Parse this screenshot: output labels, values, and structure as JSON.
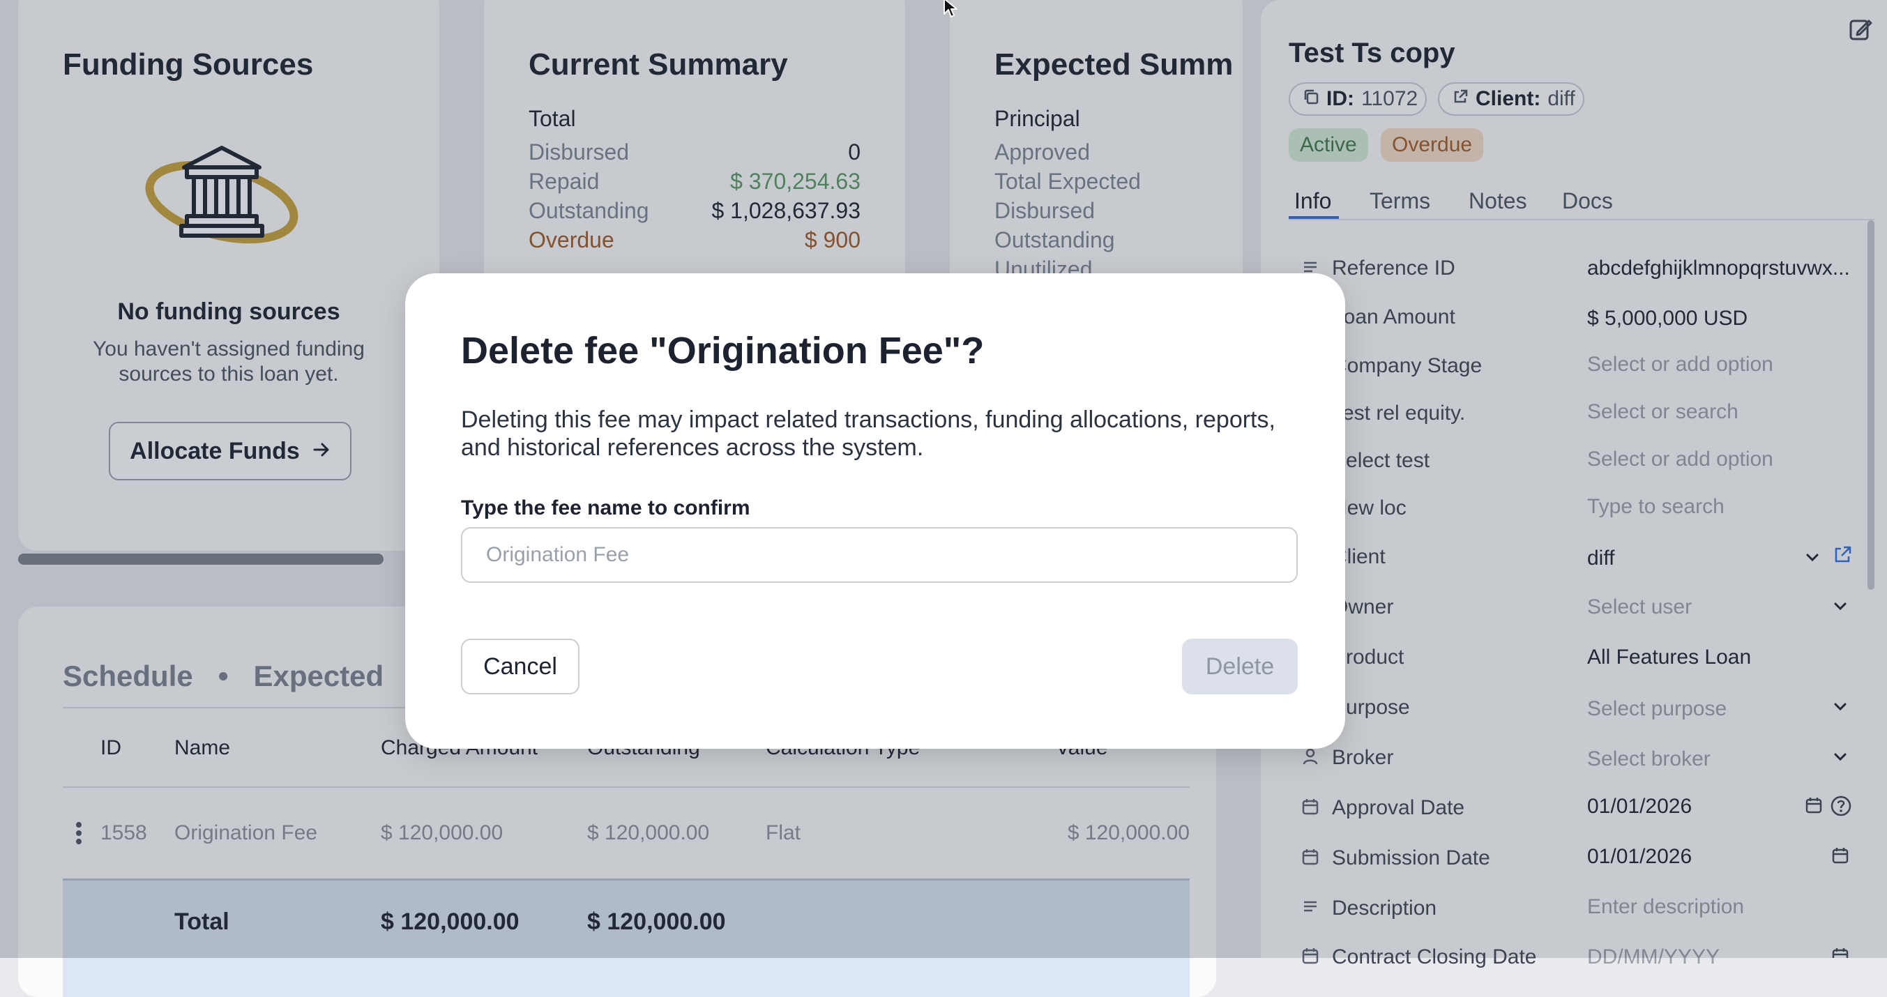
{
  "funding": {
    "title": "Funding Sources",
    "empty_title": "No funding sources",
    "empty_text_line1": "You haven't assigned funding",
    "empty_text_line2": "sources to this loan yet.",
    "allocate_label": "Allocate Funds"
  },
  "current_summary": {
    "title": "Current Summary",
    "group_label": "Total",
    "rows": [
      {
        "label": "Disbursed",
        "value": "0"
      },
      {
        "label": "Repaid",
        "value": "$ 370,254.63"
      },
      {
        "label": "Outstanding",
        "value": "$ 1,028,637.93"
      },
      {
        "label": "Overdue",
        "value": "$ 900"
      }
    ]
  },
  "expected_summary": {
    "title": "Expected Summ",
    "group_label": "Principal",
    "rows": [
      "Approved",
      "Total Expected",
      "Disbursed",
      "Outstanding",
      "Unutilized"
    ]
  },
  "table": {
    "tabs": [
      "Schedule",
      "Expected"
    ],
    "tab_separator": "•",
    "headers": [
      "ID",
      "Name",
      "Charged Amount",
      "Outstanding",
      "Calculation Type",
      "Value"
    ],
    "rows": [
      {
        "id": "1558",
        "name": "Origination Fee",
        "charged": "$ 120,000.00",
        "outstanding": "$ 120,000.00",
        "calc": "Flat",
        "value": "$ 120,000.00"
      }
    ],
    "total": {
      "label": "Total",
      "charged": "$ 120,000.00",
      "outstanding": "$ 120,000.00"
    }
  },
  "panel": {
    "title": "Test Ts copy",
    "id_label": "ID:",
    "id_value": "11072",
    "client_label": "Client:",
    "client_value": "diff",
    "badges": [
      {
        "label": "Active",
        "bg": "#d7ecd9",
        "fg": "#3f7a4a"
      },
      {
        "label": "Overdue",
        "bg": "#f6dcc8",
        "fg": "#a35a25"
      }
    ],
    "tabs": [
      "Info",
      "Terms",
      "Notes",
      "Docs"
    ],
    "fields": [
      {
        "label": "Reference ID",
        "value": "abcdefghijklmnopqrstuvwx..."
      },
      {
        "label": "Loan Amount",
        "value": "$ 5,000,000 USD"
      },
      {
        "label": "Company Stage",
        "placeholder": "Select or add option"
      },
      {
        "label": "Test rel equity.",
        "placeholder": "Select or search"
      },
      {
        "label": "Select test",
        "placeholder": "Select or add option"
      },
      {
        "label": "New loc",
        "placeholder": "Type to search"
      },
      {
        "label": "Client",
        "value": "diff"
      },
      {
        "label": "Owner",
        "placeholder": "Select user"
      },
      {
        "label": "Product",
        "value": "All Features Loan"
      },
      {
        "label": "Purpose",
        "placeholder": "Select purpose"
      },
      {
        "label": "Broker",
        "placeholder": "Select broker"
      },
      {
        "label": "Approval Date",
        "value": "01/01/2026"
      },
      {
        "label": "Submission Date",
        "value": "01/01/2026"
      },
      {
        "label": "Description",
        "placeholder": "Enter description"
      },
      {
        "label": "Contract Closing Date",
        "placeholder": "DD/MM/YYYY"
      }
    ]
  },
  "modal": {
    "title": "Delete fee \"Origination Fee\"?",
    "body": "Deleting this fee may impact related transactions, funding allocations, reports, and historical references across the system.",
    "confirm_label": "Type the fee name to confirm",
    "input_placeholder": "Origination Fee",
    "input_value": "",
    "cancel_label": "Cancel",
    "delete_label": "Delete"
  },
  "colors": {
    "repaid": "#5a9a62",
    "overdue": "#a35a25",
    "accent": "#2f6fd8",
    "bank_ring": "#c9a13a"
  }
}
